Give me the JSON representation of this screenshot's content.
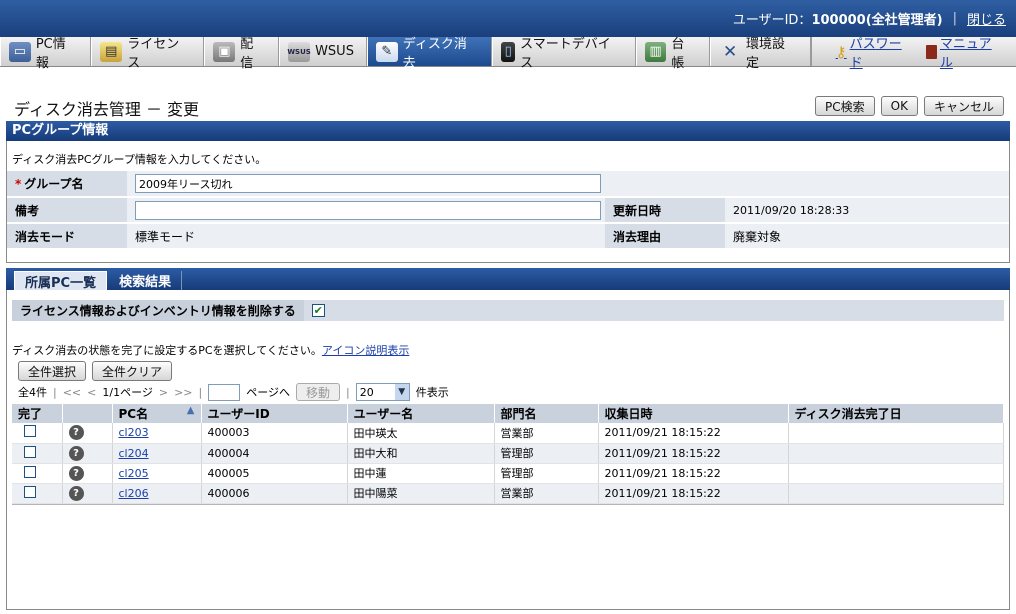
{
  "header": {
    "user_label": "ユーザーID：",
    "user_id": "100000(全社管理者)",
    "close_label": "閉じる"
  },
  "menu": {
    "items": [
      {
        "label": "PC情報",
        "icon": "pc-icon"
      },
      {
        "label": "ライセンス",
        "icon": "license-icon"
      },
      {
        "label": "配信",
        "icon": "distribution-icon"
      },
      {
        "label": "WSUS",
        "icon": "wsus-icon"
      },
      {
        "label": "ディスク消去",
        "icon": "disk-erase-icon",
        "active": true
      },
      {
        "label": "スマートデバイス",
        "icon": "smart-device-icon"
      },
      {
        "label": "台帳",
        "icon": "ledger-icon"
      },
      {
        "label": "環境設定",
        "icon": "settings-icon"
      }
    ],
    "password_label": "パスワード",
    "manual_label": "マニュアル",
    "wsus_icon_text": "WSUS"
  },
  "page": {
    "title": "ディスク消去管理 － 変更",
    "pc_search_label": "PC検索",
    "ok_label": "OK",
    "cancel_label": "キャンセル"
  },
  "group_section": {
    "header": "PCグループ情報",
    "instruction": "ディスク消去PCグループ情報を入力してください。",
    "group_name_label": "グループ名",
    "group_name_value": "2009年リース切れ",
    "note_label": "備考",
    "note_value": "",
    "updated_label": "更新日時",
    "updated_value": "2011/09/20 18:28:33",
    "mode_label": "消去モード",
    "mode_value": "標準モード",
    "reason_label": "消去理由",
    "reason_value": "廃棄対象"
  },
  "tabs": {
    "members": "所属PC一覧",
    "search_results": "検索結果"
  },
  "options": {
    "delete_label": "ライセンス情報およびインベントリ情報を削除する",
    "delete_checked": true
  },
  "list": {
    "instruction": "ディスク消去の状態を完了に設定するPCを選択してください。",
    "icon_help_link": "アイコン説明表示",
    "select_all": "全件選択",
    "clear_all": "全件クリア",
    "total": "全4件",
    "nav_first": "<<",
    "nav_prev": "<",
    "page_info": "1/1ページ",
    "nav_next": ">",
    "nav_last": ">>",
    "goto_suffix": "ページへ",
    "move_label": "移動",
    "page_size": "20",
    "page_size_suffix": "件表示",
    "columns": [
      "完了",
      "",
      "PC名",
      "ユーザーID",
      "ユーザー名",
      "部門名",
      "収集日時",
      "ディスク消去完了日"
    ],
    "rows": [
      {
        "pc": "cl203",
        "user_id": "400003",
        "user_name": "田中瑛太",
        "dept": "営業部",
        "collected": "2011/09/21 18:15:22",
        "done_date": ""
      },
      {
        "pc": "cl204",
        "user_id": "400004",
        "user_name": "田中大和",
        "dept": "管理部",
        "collected": "2011/09/21 18:15:22",
        "done_date": ""
      },
      {
        "pc": "cl205",
        "user_id": "400005",
        "user_name": "田中蓮",
        "dept": "管理部",
        "collected": "2011/09/21 18:15:22",
        "done_date": ""
      },
      {
        "pc": "cl206",
        "user_id": "400006",
        "user_name": "田中陽菜",
        "dept": "営業部",
        "collected": "2011/09/21 18:15:22",
        "done_date": ""
      }
    ]
  }
}
